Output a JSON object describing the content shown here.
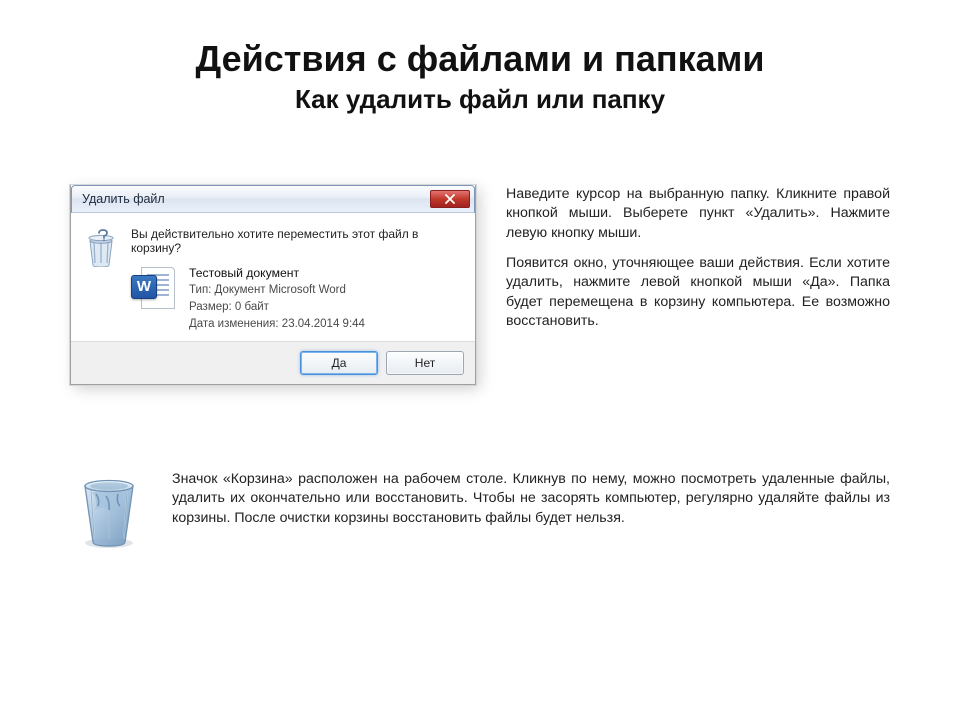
{
  "title": "Действия с файлами и папками",
  "subtitle": "Как удалить файл или папку",
  "dialog": {
    "title": "Удалить файл",
    "confirm_text": "Вы действительно хотите переместить этот файл в корзину?",
    "file": {
      "name": "Тестовый документ",
      "type_line": "Тип: Документ Microsoft Word",
      "size_line": "Размер: 0 байт",
      "date_line": "Дата изменения: 23.04.2014 9:44"
    },
    "yes_label": "Да",
    "no_label": "Нет",
    "word_letter": "W"
  },
  "instructions": {
    "p1": "Наведите курсор на выбранную папку. Кликните правой кнопкой мыши. Выберете пункт «Удалить». Нажмите левую кнопку мыши.",
    "p2": "Появится окно, уточняющее ваши действия. Если хотите удалить, нажмите левой кнопкой мыши «Да». Папка будет перемещена в корзину компьютера. Ее возможно восстановить."
  },
  "bin_paragraph": "Значок «Корзина» расположен на рабочем столе. Кликнув по нему, можно посмотреть удаленные файлы, удалить их окончательно или восстановить. Чтобы не засорять компьютер, регулярно удаляйте файлы из корзины. После очистки корзины восстановить файлы будет нельзя."
}
